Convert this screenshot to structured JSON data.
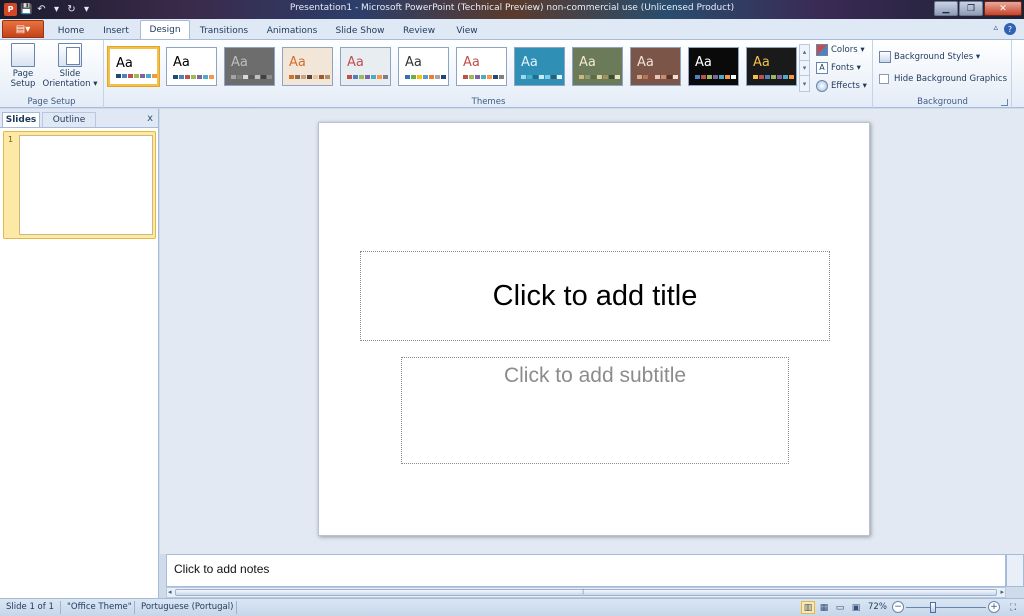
{
  "window": {
    "title": "Presentation1 - Microsoft PowerPoint (Technical Preview) non-commercial use (Unlicensed Product)",
    "app_logo": "P",
    "controls": {
      "minimize": "▁",
      "restore": "❐",
      "close": "✕"
    }
  },
  "quick_access": {
    "save_icon": "💾",
    "undo_icon": "↶",
    "redo_icon": "↻",
    "dropdown": "▾"
  },
  "tabs": [
    {
      "label": "Home",
      "active": false
    },
    {
      "label": "Insert",
      "active": false
    },
    {
      "label": "Design",
      "active": true
    },
    {
      "label": "Transitions",
      "active": false
    },
    {
      "label": "Animations",
      "active": false
    },
    {
      "label": "Slide Show",
      "active": false
    },
    {
      "label": "Review",
      "active": false
    },
    {
      "label": "View",
      "active": false
    }
  ],
  "file_button": {
    "icon": "▤▾"
  },
  "help": {
    "label": "?",
    "minimize_ribbon": "▵"
  },
  "ribbon": {
    "page_setup": {
      "group_label": "Page Setup",
      "page_setup_label": "Page\nSetup",
      "orientation_label": "Slide\nOrientation ▾"
    },
    "themes": {
      "group_label": "Themes",
      "items": [
        {
          "label": "Aa",
          "bg": "#ffffff",
          "fg": "#000000",
          "selected": true,
          "swatches": [
            "#1f497d",
            "#4f81bd",
            "#c0504d",
            "#9bbb59",
            "#8064a2",
            "#4bacc6",
            "#f79646"
          ]
        },
        {
          "label": "Aa",
          "bg": "#ffffff",
          "fg": "#000000",
          "selected": false,
          "swatches": [
            "#1f497d",
            "#4f81bd",
            "#c0504d",
            "#9bbb59",
            "#8064a2",
            "#4bacc6",
            "#f79646"
          ]
        },
        {
          "label": "Aa",
          "bg": "#6d6d6d",
          "fg": "#bfbfbf",
          "selected": false,
          "swatches": [
            "#a5a5a5",
            "#7f7f7f",
            "#d9d9d9",
            "#595959",
            "#c0c0c0",
            "#404040",
            "#8c8c8c"
          ]
        },
        {
          "label": "Aa",
          "bg": "#f2e6d9",
          "fg": "#d46f2a",
          "selected": false,
          "swatches": [
            "#d46f2a",
            "#8b6b4a",
            "#c7a27c",
            "#5b4636",
            "#e9c49a",
            "#9e5c2e",
            "#b08d6a"
          ]
        },
        {
          "label": "Aa",
          "bg": "#e8edf2",
          "fg": "#c0504d",
          "selected": false,
          "swatches": [
            "#c0504d",
            "#4f81bd",
            "#9bbb59",
            "#8064a2",
            "#4bacc6",
            "#f79646",
            "#7f7f7f"
          ]
        },
        {
          "label": "Aa",
          "bg": "#ffffff",
          "fg": "#333333",
          "selected": false,
          "swatches": [
            "#2e75b6",
            "#70ad47",
            "#ffc000",
            "#5b9bd5",
            "#ed7d31",
            "#a5a5a5",
            "#264478"
          ]
        },
        {
          "label": "Aa",
          "bg": "#ffffff",
          "fg": "#c0504d",
          "selected": false,
          "swatches": [
            "#c0504d",
            "#9bbb59",
            "#8064a2",
            "#4bacc6",
            "#f79646",
            "#1f497d",
            "#7f7f7f"
          ]
        },
        {
          "label": "Aa",
          "bg": "#2f8fb5",
          "fg": "#dff3fb",
          "selected": false,
          "swatches": [
            "#9fd9ef",
            "#4bacc6",
            "#1f6f8f",
            "#c6eaf6",
            "#7ecbe4",
            "#2b5d73",
            "#e5f6fb"
          ]
        },
        {
          "label": "Aa",
          "bg": "#6b7a58",
          "fg": "#f0ead2",
          "selected": false,
          "swatches": [
            "#c9b97a",
            "#8f9a6c",
            "#5e6b44",
            "#d8cfa4",
            "#a3935a",
            "#3f4a2b",
            "#e9e1bd"
          ]
        },
        {
          "label": "Aa",
          "bg": "#7a5548",
          "fg": "#f2e2d6",
          "selected": false,
          "swatches": [
            "#d8a88c",
            "#b5765a",
            "#8a4f3a",
            "#e8c6b2",
            "#c48e74",
            "#5c3326",
            "#f3ddd0"
          ]
        },
        {
          "label": "Aa",
          "bg": "#0a0a0a",
          "fg": "#ffffff",
          "selected": false,
          "swatches": [
            "#4f81bd",
            "#c0504d",
            "#9bbb59",
            "#8064a2",
            "#4bacc6",
            "#f79646",
            "#ffffff"
          ]
        },
        {
          "label": "Aa",
          "bg": "#1a1a1a",
          "fg": "#f2c14b",
          "selected": false,
          "swatches": [
            "#f2c14b",
            "#c0504d",
            "#4f81bd",
            "#9bbb59",
            "#8064a2",
            "#4bacc6",
            "#f79646"
          ]
        }
      ],
      "scroll": [
        "▴",
        "▾",
        "▾"
      ]
    },
    "theme_options": {
      "colors": "Colors ▾",
      "fonts": "Fonts ▾",
      "effects": "Effects ▾",
      "fonts_icon": "A"
    },
    "background": {
      "group_label": "Background",
      "styles": "Background Styles ▾",
      "hide_graphics": "Hide Background Graphics"
    }
  },
  "left_panel": {
    "tab_slides": "Slides",
    "tab_outline": "Outline",
    "close": "x",
    "slide_number": "1"
  },
  "slide": {
    "title_placeholder": "Click to add title",
    "subtitle_placeholder": "Click to add subtitle"
  },
  "notes": {
    "placeholder": "Click to add notes"
  },
  "scroll": {
    "left": "◂",
    "right": "▸",
    "grip": "⁞"
  },
  "status": {
    "slide_info": "Slide 1 of 1",
    "theme": "\"Office Theme\"",
    "language": "Portuguese (Portugal)",
    "zoom": "72%",
    "zoom_out": "−",
    "zoom_in": "+",
    "fit": "⛶"
  }
}
